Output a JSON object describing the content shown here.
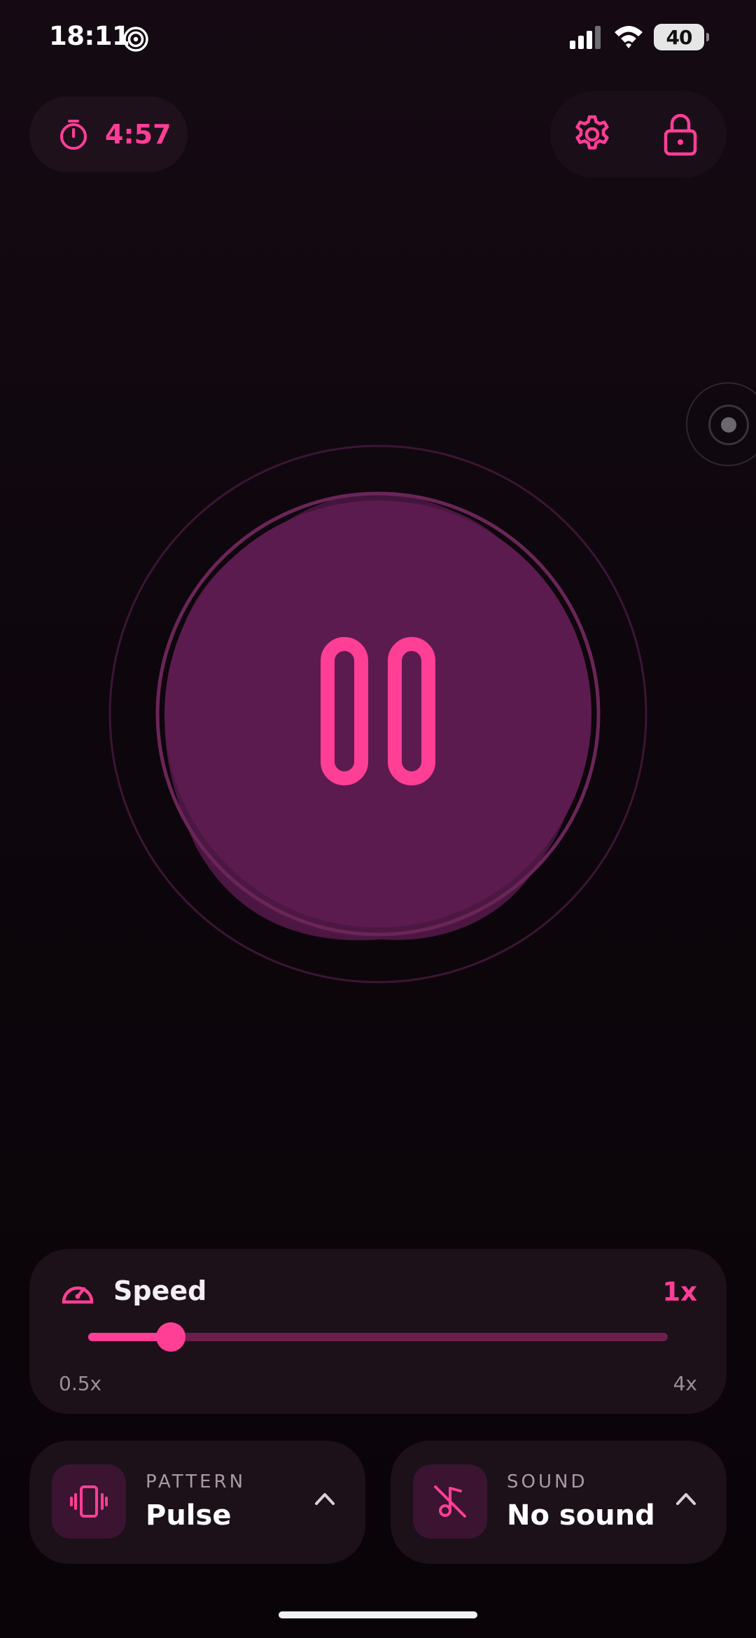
{
  "status_bar": {
    "time": "18:11",
    "battery_level": "40",
    "app_icon": "spiral-icon",
    "signal_icon": "cellular-signal-icon",
    "wifi_icon": "wifi-icon"
  },
  "timer": {
    "icon": "stopwatch-icon",
    "remaining": "4:57"
  },
  "top_actions": {
    "settings_icon": "gear-icon",
    "lock_icon": "lock-icon"
  },
  "center": {
    "control_icon": "pause-icon"
  },
  "speed": {
    "icon": "speedometer-icon",
    "label": "Speed",
    "value": "1x",
    "min_label": "0.5x",
    "max_label": "4x",
    "current": 1,
    "min": 0.5,
    "max": 4
  },
  "pattern": {
    "icon": "vibration-icon",
    "caption": "PATTERN",
    "value": "Pulse",
    "chevron": "chevron-up-icon"
  },
  "sound": {
    "icon": "music-off-icon",
    "caption": "SOUND",
    "value": "No sound",
    "chevron": "chevron-up-icon"
  },
  "colors": {
    "accent": "#ff3e96",
    "orb_fill": "#5c1b4e",
    "card_bg": "#1c1019",
    "background": "#0b050a"
  }
}
